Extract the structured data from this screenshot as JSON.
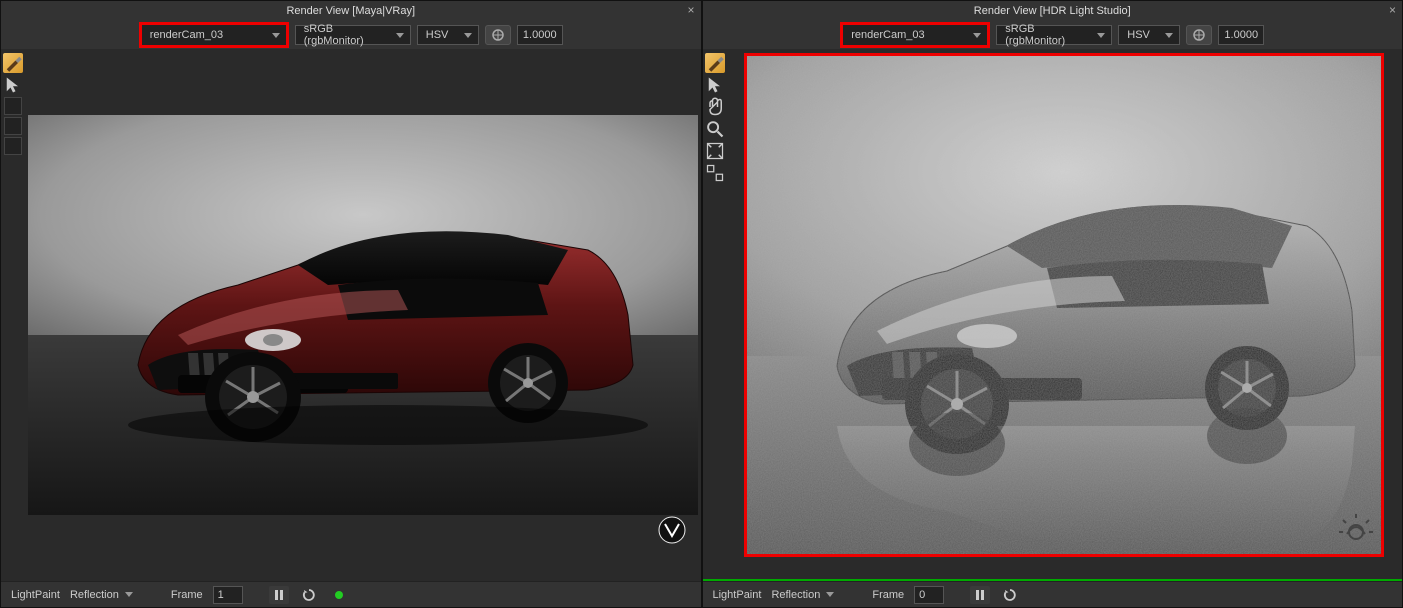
{
  "panels": [
    {
      "title": "Render View [Maya|VRay]",
      "camera": "renderCam_03",
      "colorspace": "sRGB (rgbMonitor)",
      "mode": "HSV",
      "gamma": "1.0000",
      "status": {
        "mode_label": "LightPaint",
        "mode_value": "Reflection",
        "frame_label": "Frame",
        "frame_value": "1"
      }
    },
    {
      "title": "Render View [HDR Light Studio]",
      "camera": "renderCam_03",
      "colorspace": "sRGB (rgbMonitor)",
      "mode": "HSV",
      "gamma": "1.0000",
      "status": {
        "mode_label": "LightPaint",
        "mode_value": "Reflection",
        "frame_label": "Frame",
        "frame_value": "0"
      }
    }
  ]
}
